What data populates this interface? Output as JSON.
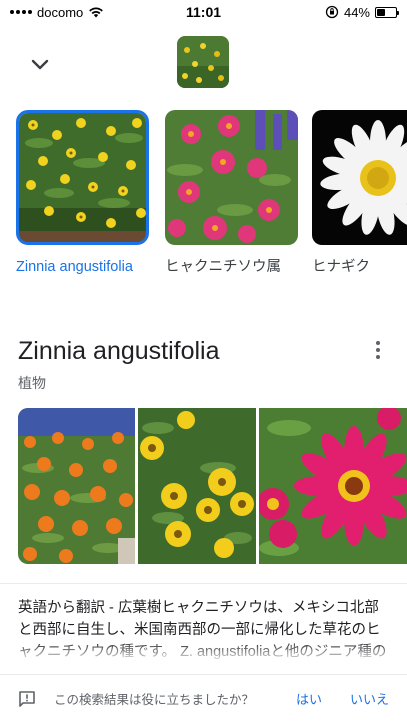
{
  "status_bar": {
    "carrier": "docomo",
    "time": "11:01",
    "battery": "44%",
    "battery_level": 0.44
  },
  "carousel": [
    {
      "label": "Zinnia angustifolia",
      "selected": true
    },
    {
      "label": "ヒャクニチソウ属",
      "selected": false
    },
    {
      "label": "ヒナギク",
      "selected": false
    }
  ],
  "result": {
    "title": "Zinnia angustifolia",
    "subtitle": "植物",
    "description": "英語から翻訳 - 広葉樹ヒャクニチソウは、メキシコ北部と西部に自生し、米国南西部の一部に帰化した草花のヒャクニチソウの種です。 Z. angustifoliaと他のジニア種の雑種は、ジニアの品種に使用されています。"
  },
  "feedback": {
    "question": "この検索結果は役に立ちましたか？",
    "yes": "はい",
    "no": "いいえ"
  },
  "colors": {
    "accent": "#1a73e8",
    "text": "#202124",
    "secondary": "#5f6368"
  },
  "icons": [
    "signal-icon",
    "wifi-icon",
    "rotation-lock-icon",
    "battery-icon",
    "chevron-down-icon",
    "more-vert-icon",
    "feedback-icon"
  ]
}
